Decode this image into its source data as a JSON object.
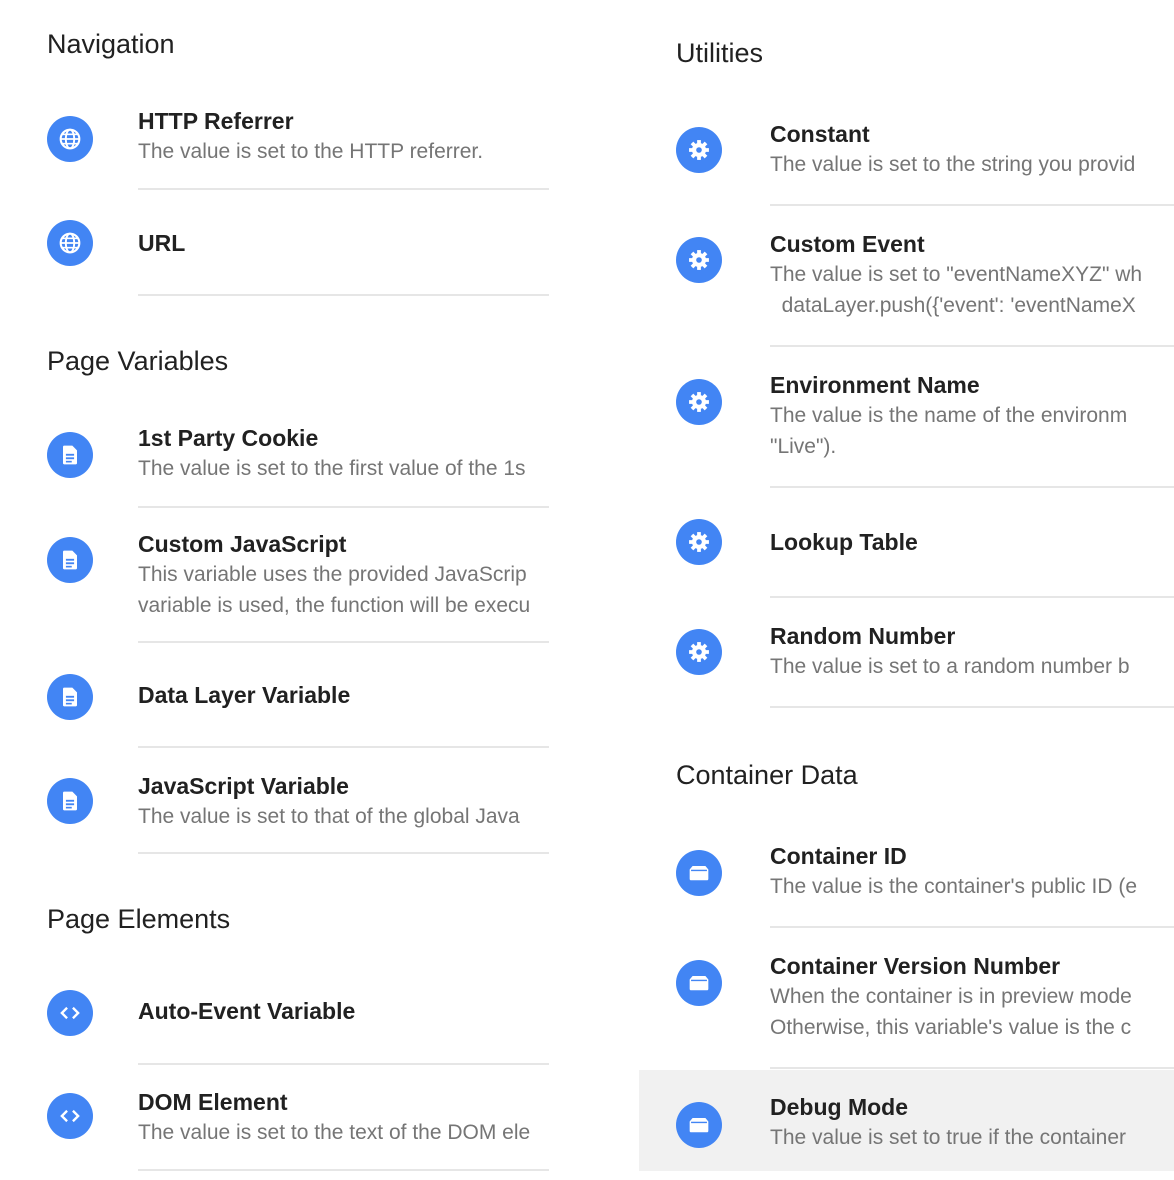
{
  "colors": {
    "accent": "#4285f4",
    "divider": "#e6e6e6",
    "highlight": "#f1f1f1"
  },
  "navigation": {
    "title": "Navigation",
    "items": [
      {
        "title": "HTTP Referrer",
        "desc": "The value is set to the HTTP referrer.",
        "icon": "globe-icon"
      },
      {
        "title": "URL",
        "icon": "globe-icon"
      }
    ]
  },
  "page_variables": {
    "title": "Page Variables",
    "items": [
      {
        "title": "1st Party Cookie",
        "desc": "The value is set to the first value of the 1s",
        "icon": "document-icon"
      },
      {
        "title": "Custom JavaScript",
        "desc": "This variable uses the provided JavaScrip",
        "desc2": "variable is used, the function will be execu",
        "icon": "document-icon"
      },
      {
        "title": "Data Layer Variable",
        "icon": "document-icon"
      },
      {
        "title": "JavaScript Variable",
        "desc": "The value is set to that of the global Java",
        "icon": "document-icon"
      }
    ]
  },
  "page_elements": {
    "title": "Page Elements",
    "items": [
      {
        "title": "Auto-Event Variable",
        "icon": "code-icon"
      },
      {
        "title": "DOM Element",
        "desc": "The value is set to the text of the DOM ele",
        "icon": "code-icon"
      }
    ]
  },
  "utilities": {
    "title": "Utilities",
    "items": [
      {
        "title": "Constant",
        "desc": "The value is set to the string you provid",
        "icon": "gear-icon"
      },
      {
        "title": "Custom Event",
        "desc": "The value is set to \"eventNameXYZ\" wh",
        "desc2": "  dataLayer.push({'event': 'eventNameX",
        "icon": "gear-icon"
      },
      {
        "title": "Environment Name",
        "desc": "The value is the name of the environm",
        "desc2": "\"Live\").",
        "icon": "gear-icon"
      },
      {
        "title": "Lookup Table",
        "icon": "gear-icon"
      },
      {
        "title": "Random Number",
        "desc": "The value is set to a random number b",
        "icon": "gear-icon"
      }
    ]
  },
  "container_data": {
    "title": "Container Data",
    "items": [
      {
        "title": "Container ID",
        "desc": "The value is the container's public ID (e",
        "icon": "container-icon"
      },
      {
        "title": "Container Version Number",
        "desc": "When the container is in preview mode",
        "desc2": "Otherwise, this variable's value is the c",
        "icon": "container-icon"
      },
      {
        "title": "Debug Mode",
        "desc": "The value is set to true if the container",
        "icon": "container-icon",
        "highlighted": true
      }
    ]
  }
}
